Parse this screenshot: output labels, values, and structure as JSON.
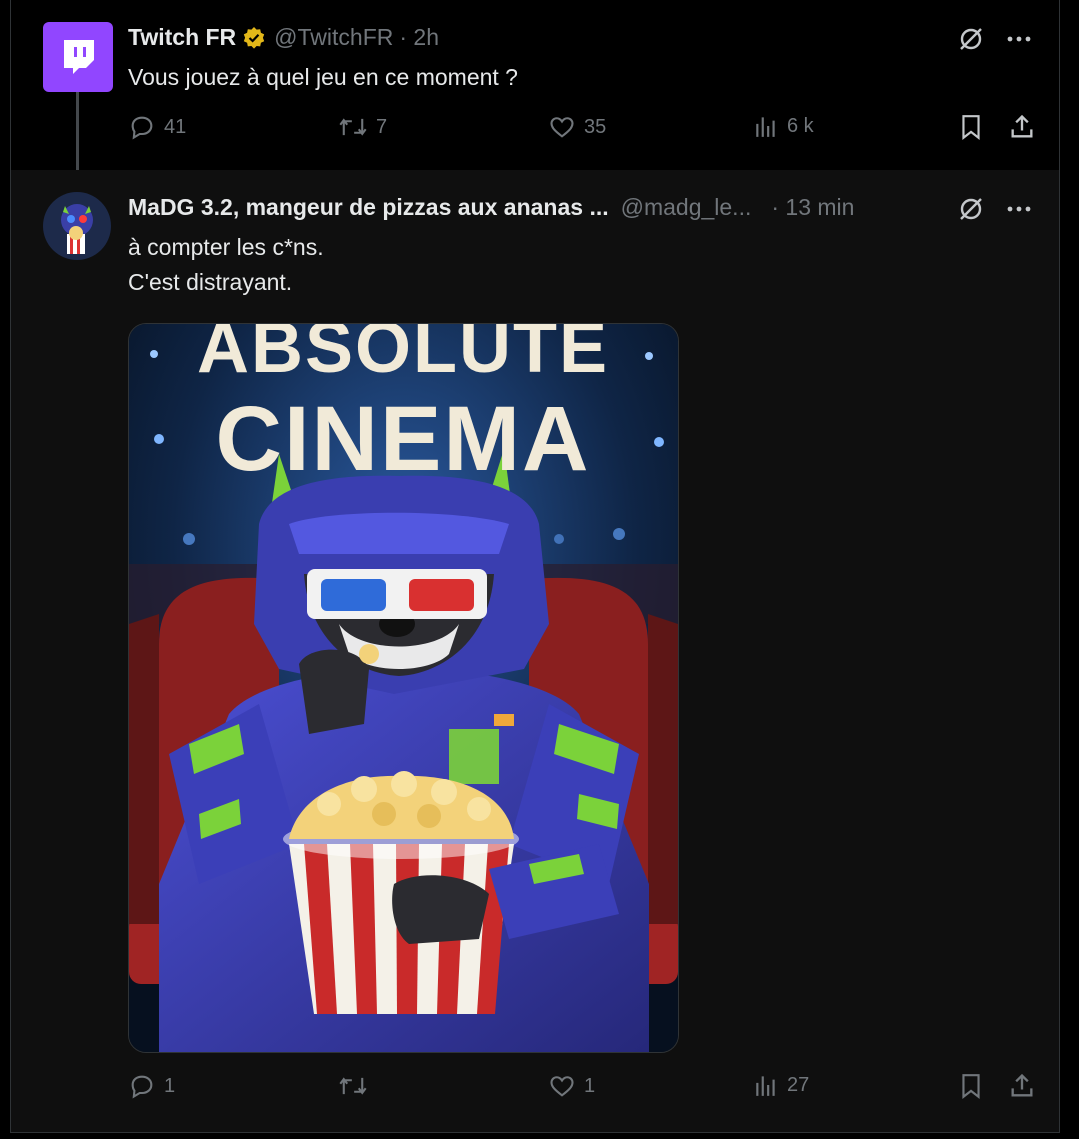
{
  "tweet1": {
    "name": "Twitch FR",
    "handle": "@TwitchFR",
    "time": "· 2h",
    "text": "Vous jouez à quel jeu en ce moment ?",
    "stats": {
      "replies": "41",
      "reposts": "7",
      "likes": "35",
      "views": "6 k"
    }
  },
  "tweet2": {
    "name": "MaDG 3.2, mangeur de pizzas aux ananas ...",
    "handle": "@madg_le...",
    "time": "· 13 min",
    "text_line1": "à compter les c*ns.",
    "text_line2": "C'est distrayant.",
    "image": {
      "title_line1": "ABSOLUTE",
      "title_line2": "CINEMA"
    },
    "stats": {
      "replies": "1",
      "reposts": "",
      "likes": "1",
      "views": "27"
    }
  },
  "colors": {
    "twitch_purple": "#9146ff",
    "verified_gold": "#e2b719",
    "muted": "#71767b"
  }
}
